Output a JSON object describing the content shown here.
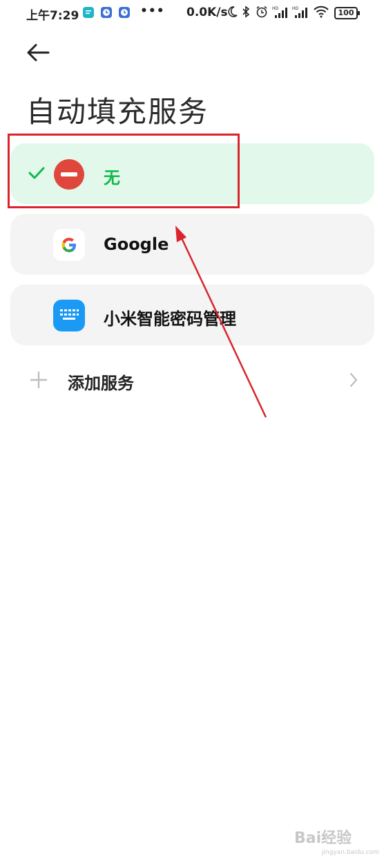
{
  "status_bar": {
    "time": "上午7:29",
    "more": "•••",
    "net_speed": "0.0K/s",
    "battery": "100",
    "icons": [
      "message-notif-icon",
      "clock-notif-icon",
      "clock-notif-icon",
      "moon-icon",
      "bluetooth-icon",
      "alarm-icon",
      "signal-hd-icon",
      "signal-hd-icon",
      "wifi-icon",
      "battery-icon"
    ]
  },
  "header": {
    "back_icon": "arrow-left-icon",
    "title": "自动填充服务"
  },
  "services": [
    {
      "label": "无",
      "selected": true,
      "icon": "none-minus-icon"
    },
    {
      "label": "Google",
      "selected": false,
      "icon": "google-icon"
    },
    {
      "label": "小米智能密码管理",
      "selected": false,
      "icon": "keyboard-icon"
    }
  ],
  "add_service": {
    "label": "添加服务",
    "icon": "plus-icon",
    "chevron": "chevron-right-icon"
  },
  "colors": {
    "selected_bg": "#e2f8ea",
    "selected_text": "#12b84c",
    "card_bg": "#f4f4f4",
    "annotation_red": "#d9242c",
    "xiaomi_blue": "#1a9af5"
  },
  "watermark": {
    "logo": "Bai经验",
    "url": "jingyan.baidu.com"
  }
}
